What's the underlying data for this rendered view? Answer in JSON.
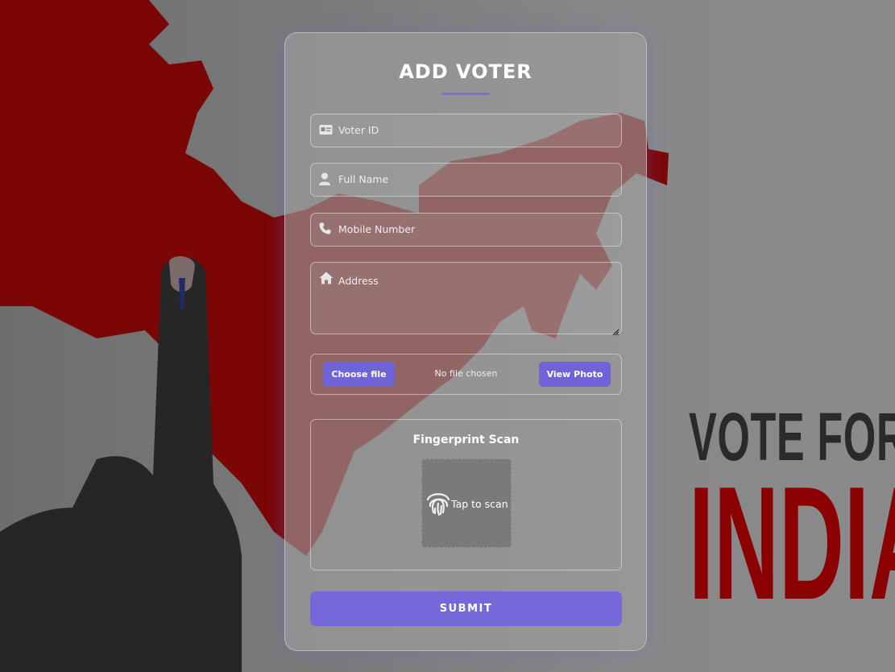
{
  "form": {
    "title": "ADD VOTER",
    "fields": {
      "voter_id": {
        "placeholder": "Voter ID",
        "icon": "id-card-icon"
      },
      "full_name": {
        "placeholder": "Full Name",
        "icon": "user-icon"
      },
      "mobile": {
        "placeholder": "Mobile Number",
        "icon": "phone-icon"
      },
      "address": {
        "placeholder": "Address",
        "icon": "home-icon"
      }
    },
    "photo": {
      "choose_label": "Choose file",
      "status": "No file chosen",
      "view_label": "View Photo"
    },
    "fingerprint": {
      "title": "Fingerprint Scan",
      "scan_label": "Tap to scan",
      "icon": "fingerprint-icon"
    },
    "submit_label": "SUBMIT"
  },
  "background": {
    "slogan_line1": "VOTE FOR",
    "slogan_line2": "INDIA"
  },
  "colors": {
    "accent": "#7569d9",
    "map_red": "#8b0000",
    "text": "#ffffff"
  }
}
